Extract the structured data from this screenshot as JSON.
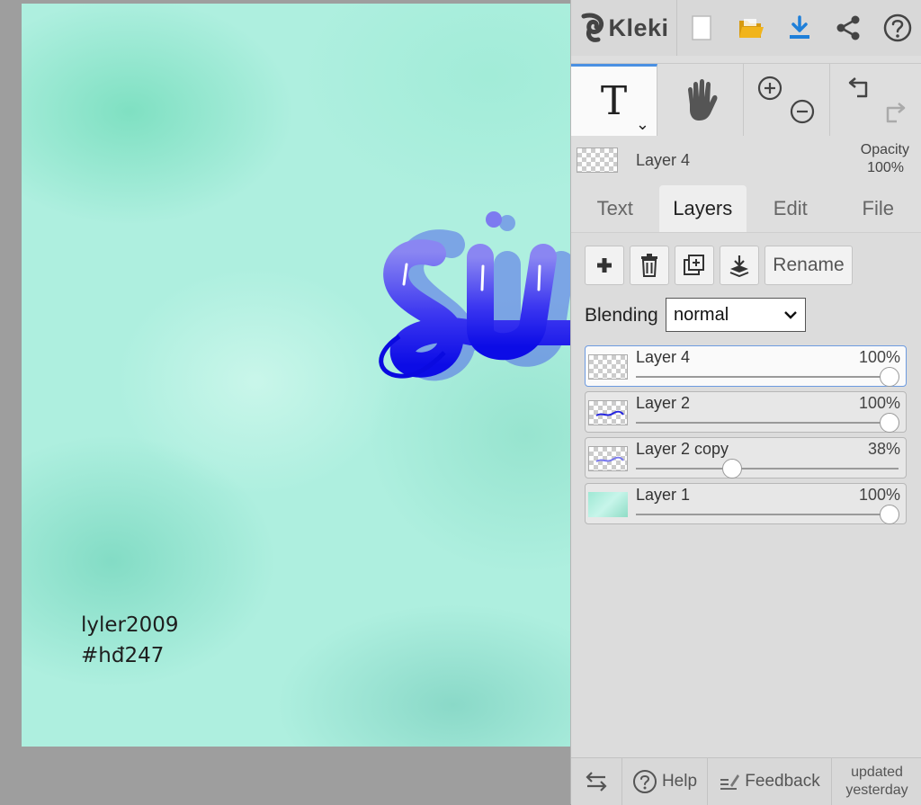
{
  "app": {
    "name": "Kleki"
  },
  "canvas": {
    "art_text": "su",
    "credit_line1": "lyler2009",
    "credit_line2": "#hđ247",
    "colors": {
      "text_blue": "#1010e8",
      "text_light": "#8a86f2",
      "bg_mint": "#aeefdf"
    }
  },
  "toolbar": {
    "icons": [
      "new-file-icon",
      "open-folder-icon",
      "download-icon",
      "share-icon",
      "help-icon"
    ]
  },
  "tools": {
    "text_tool_glyph": "T",
    "text_tool_chevron": "⌄"
  },
  "current_layer": {
    "name": "Layer 4",
    "opacity_label": "Opacity",
    "opacity_value": "100%"
  },
  "tabs": [
    {
      "label": "Text",
      "active": false
    },
    {
      "label": "Layers",
      "active": true
    },
    {
      "label": "Edit",
      "active": false
    },
    {
      "label": "File",
      "active": false
    }
  ],
  "layers_panel": {
    "rename_label": "Rename",
    "blending_label": "Blending",
    "blending_value": "normal",
    "layers": [
      {
        "name": "Layer 4",
        "opacity": "100%",
        "opacity_fraction": 1.0,
        "active": true,
        "thumb": "empty"
      },
      {
        "name": "Layer 2",
        "opacity": "100%",
        "opacity_fraction": 1.0,
        "active": false,
        "thumb": "text"
      },
      {
        "name": "Layer 2 copy",
        "opacity": "38%",
        "opacity_fraction": 0.38,
        "active": false,
        "thumb": "text-faint"
      },
      {
        "name": "Layer 1",
        "opacity": "100%",
        "opacity_fraction": 1.0,
        "active": false,
        "thumb": "mint"
      }
    ]
  },
  "bottom_bar": {
    "help_label": "Help",
    "feedback_label": "Feedback",
    "updated_line1": "updated",
    "updated_line2": "yesterday"
  },
  "colors": {
    "accent": "#4a90e2",
    "download_blue": "#1e7fd9",
    "folder_yellow": "#f1b41b"
  }
}
